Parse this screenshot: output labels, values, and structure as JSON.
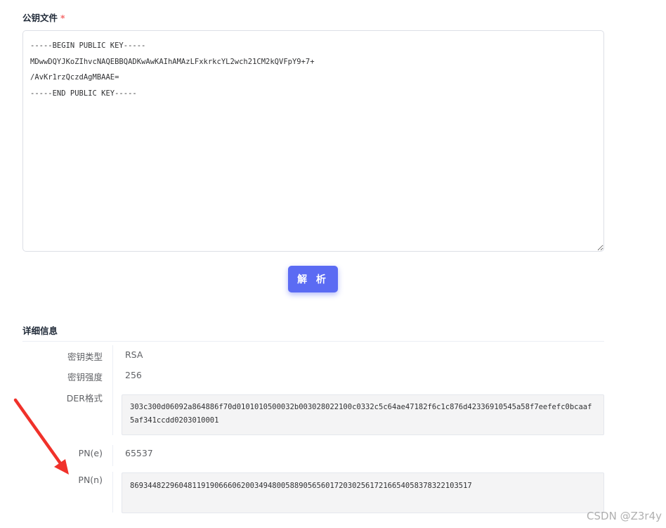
{
  "form": {
    "label": "公钥文件",
    "required_mark": "*",
    "key_text": "-----BEGIN PUBLIC KEY-----\nMDwwDQYJKoZIhvcNAQEBBQADKwAwKAIhAMAzLFxkrkcYL2wch21CM2kQVFpY9+7+\n/AvKr1rzQczdAgMBAAE=\n-----END PUBLIC KEY-----",
    "parse_button": "解 析"
  },
  "details": {
    "title": "详细信息",
    "rows": [
      {
        "label": "密钥类型",
        "value": "RSA"
      },
      {
        "label": "密钥强度",
        "value": "256"
      },
      {
        "label": "DER格式",
        "value": "303c300d06092a864886f70d0101010500032b003028022100c0332c5c64ae47182f6c1c876d42336910545a58f7eefefc0bcaaf5af341ccdd0203010001"
      },
      {
        "label": "PN(e)",
        "value": "65537"
      },
      {
        "label": "PN(n)",
        "value": "86934482296048119190666062003494800588905656017203025617216654058378322103517"
      }
    ]
  },
  "annotation": {
    "arrow_color": "#f0312a"
  },
  "watermark": "CSDN @Z3r4y"
}
